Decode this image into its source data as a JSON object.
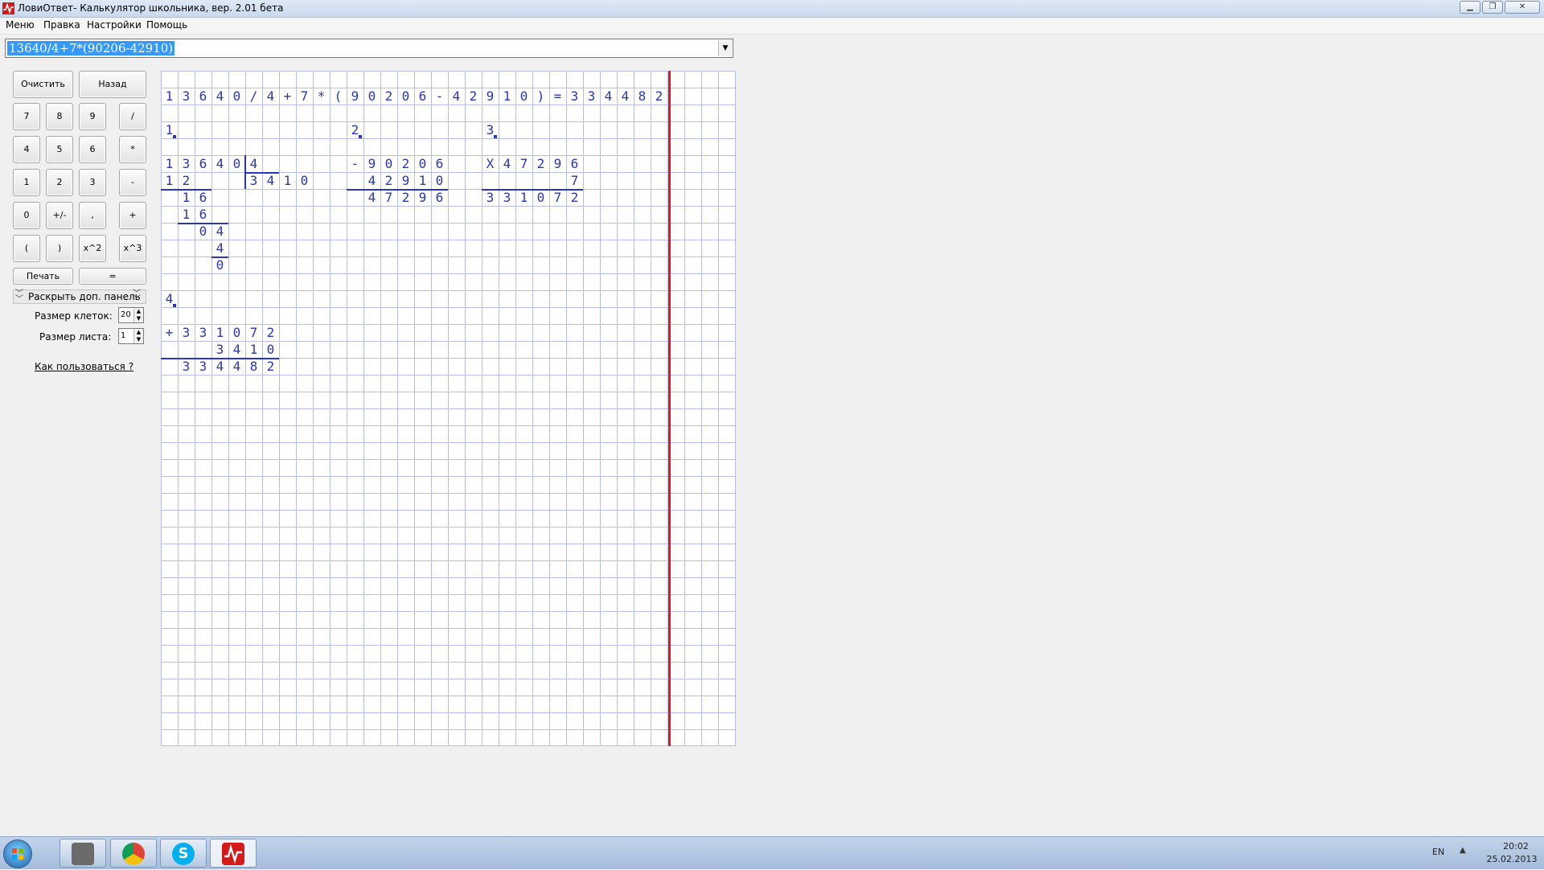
{
  "window": {
    "title": "ЛовиОтвет- Калькулятор школьника, вер.  2.01 бета"
  },
  "menu": [
    "Меню",
    "Правка",
    "Настройки",
    "Помощь"
  ],
  "expression": {
    "value": "13640/4+7*(90206-42910)"
  },
  "buttons": {
    "clear": "Очистить",
    "back": "Назад",
    "seven": "7",
    "eight": "8",
    "nine": "9",
    "divide": "/",
    "four": "4",
    "five": "5",
    "six": "6",
    "multiply": "*",
    "one": "1",
    "two": "2",
    "three": "3",
    "minus": "-",
    "zero": "0",
    "plusminus": "+/-",
    "comma": ",",
    "plus": "+",
    "lparen": "(",
    "rparen": ")",
    "square": "x^2",
    "cube": "x^3",
    "print": "Печать",
    "equals": "="
  },
  "panel": {
    "expand_label": "Раскрыть доп. панель",
    "cell_size_label": "Размер клеток:",
    "cell_size_value": "20",
    "sheet_size_label": "Размер листа:",
    "sheet_size_value": "1",
    "help_link": "Как пользоваться ?"
  },
  "sheet": {
    "equation": "13640/4+7*(90206-42910)=334482",
    "steps": [
      "1",
      "2",
      "3",
      "4"
    ],
    "division": {
      "dividend": "13640",
      "divisor": "4",
      "quotient": "3410",
      "rows": [
        "12",
        "16",
        "16",
        "04",
        "4",
        "0"
      ]
    },
    "subtraction": {
      "sign": "-",
      "minuend": "90206",
      "subtrahend": "42910",
      "result": "47296"
    },
    "multiplication": {
      "sign": "X",
      "multiplicand": "47296",
      "multiplier": "7",
      "result": "331072"
    },
    "addition": {
      "sign": "+",
      "addend1": "331072",
      "addend2": "3410",
      "result": "334482"
    }
  },
  "taskbar": {
    "lang": "EN",
    "time": "20:02",
    "date": "25.02.2013"
  },
  "colors": {
    "ink": "#2a36b8",
    "grid": "#b6bde7",
    "margin": "#e4191c",
    "selection": "#3399ff"
  }
}
